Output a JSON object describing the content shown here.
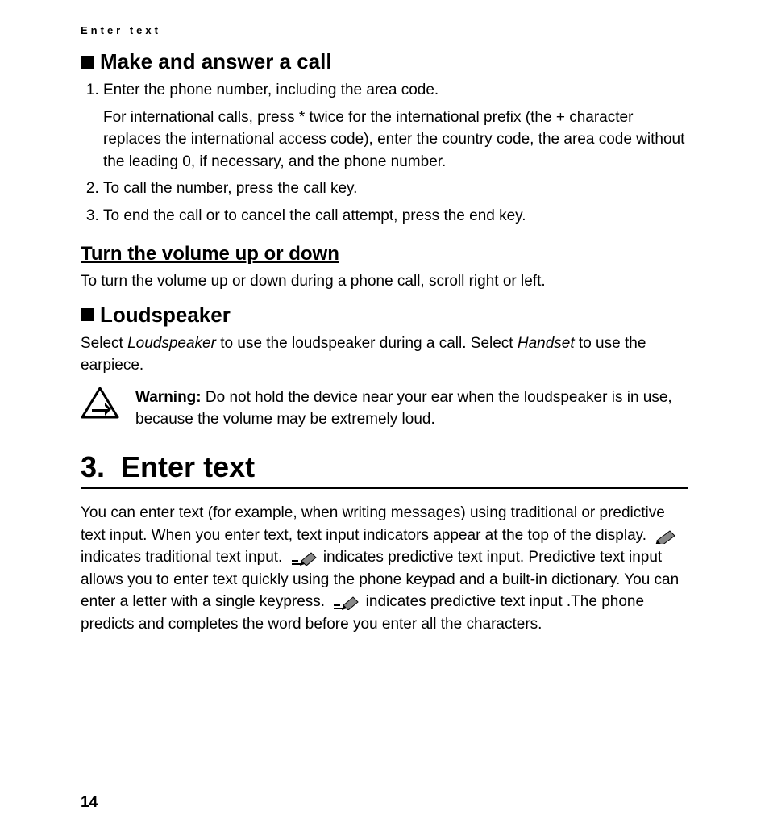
{
  "running_header": "Enter text",
  "section_make_call": {
    "title": "Make and answer a call",
    "steps": [
      {
        "text": "Enter the phone number, including the area code.",
        "sub": "For international calls, press * twice for the international prefix (the + character replaces the international access code), enter the country code, the area code without the leading 0, if necessary, and the phone number."
      },
      {
        "text": "To call the number, press the call key."
      },
      {
        "text": "To end the call or to cancel the call attempt, press the end key."
      }
    ]
  },
  "section_volume": {
    "title": "Turn the volume up or down",
    "body": "To turn the volume up or down during a phone call, scroll right or left."
  },
  "section_loudspeaker": {
    "title": "Loudspeaker",
    "body_pre": "Select ",
    "body_italic1": "Loudspeaker",
    "body_mid": " to use the loudspeaker during a call. Select ",
    "body_italic2": "Handset",
    "body_post": " to use the earpiece.",
    "warning_label": "Warning:",
    "warning_text": " Do not hold the device near your ear when the loudspeaker is in use, because the volume may be extremely loud."
  },
  "chapter": {
    "number": "3.",
    "title": "Enter text",
    "body_a": "You can enter text (for example, when writing messages) using traditional or predictive text input. When you enter text, text input indicators appear at the top of the display. ",
    "body_b": " indicates traditional text input. ",
    "body_c": " indicates predictive text input. Predictive text input allows you to enter text quickly using the phone keypad and a built-in dictionary. You can enter a letter with a single keypress. ",
    "body_d": " indicates predictive text input .The phone predicts and completes the word before you enter all the characters."
  },
  "page_number": "14"
}
